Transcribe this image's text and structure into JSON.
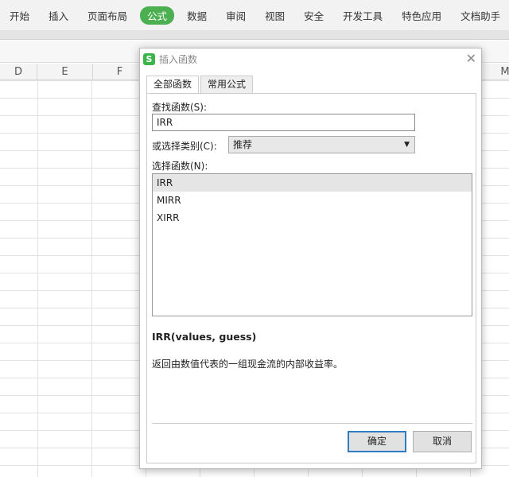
{
  "ribbon": {
    "tabs": [
      "开始",
      "插入",
      "页面布局",
      "公式",
      "数据",
      "审阅",
      "视图",
      "安全",
      "开发工具",
      "特色应用",
      "文档助手"
    ],
    "active": "公式",
    "accent": "#4caf50"
  },
  "columns": [
    "D",
    "E",
    "F",
    "M"
  ],
  "dialog": {
    "title": "插入函数",
    "tabs": [
      "全部函数",
      "常用公式"
    ],
    "search_label": "查找函数(S):",
    "search_value": "IRR",
    "category_label": "或选择类别(C):",
    "category_value": "推荐",
    "list_label": "选择函数(N):",
    "functions": [
      "IRR",
      "MIRR",
      "XIRR"
    ],
    "signature": "IRR(values, guess)",
    "description": "返回由数值代表的一组现金流的内部收益率。",
    "ok": "确定",
    "cancel": "取消"
  }
}
